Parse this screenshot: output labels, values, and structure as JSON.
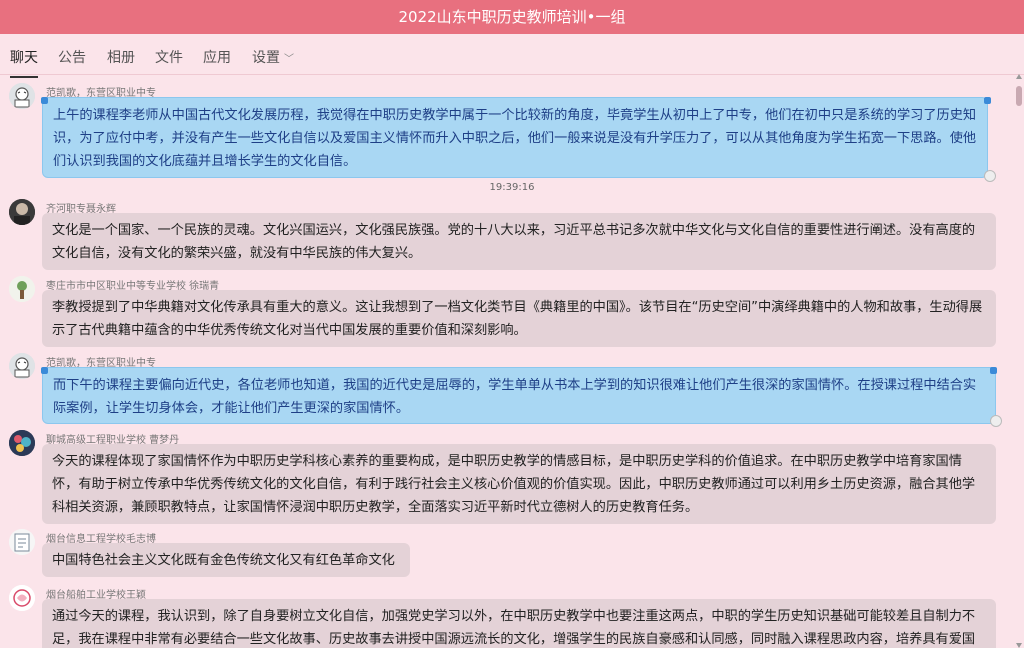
{
  "window": {
    "title": "2022山东中职历史教师培训•一组"
  },
  "tabs": [
    {
      "label": "聊天"
    },
    {
      "label": "公告"
    },
    {
      "label": "相册"
    },
    {
      "label": "文件"
    },
    {
      "label": "应用"
    },
    {
      "label": "设置"
    }
  ],
  "messages": [
    {
      "sender": "范凯歌，东营区职业中专",
      "text": "上午的课程李老师从中国古代文化发展历程，我觉得在中职历史教学中属于一个比较新的角度，毕竟学生从初中上了中专，他们在初中只是系统的学习了历史知识，为了应付中考，并没有产生一些文化自信以及爱国主义情怀而升入中职之后，他们一般来说是没有升学压力了，可以从其他角度为学生拓宽一下思路。使他们认识到我国的文化底蕴并且增长学生的文化自信。"
    },
    {
      "sender": "齐河职专聂永辉",
      "text": "文化是一个国家、一个民族的灵魂。文化兴国运兴，文化强民族强。党的十八大以来，习近平总书记多次就中华文化与文化自信的重要性进行阐述。没有高度的文化自信，没有文化的繁荣兴盛，就没有中华民族的伟大复兴。"
    },
    {
      "sender": "枣庄市市中区职业中等专业学校  徐瑞青",
      "text": "李教授提到了中华典籍对文化传承具有重大的意义。这让我想到了一档文化类节目《典籍里的中国》。该节目在“历史空间”中演绎典籍中的人物和故事，生动得展示了古代典籍中蕴含的中华优秀传统文化对当代中国发展的重要价值和深刻影响。"
    },
    {
      "sender": "范凯歌，东营区职业中专",
      "text": "而下午的课程主要偏向近代史，各位老师也知道，我国的近代史是屈辱的，学生单单从书本上学到的知识很难让他们产生很深的家国情怀。在授课过程中结合实际案例，让学生切身体会，才能让他们产生更深的家国情怀。"
    },
    {
      "sender": "聊城高级工程职业学校 曹梦丹",
      "text": "今天的课程体现了家国情怀作为中职历史学科核心素养的重要构成，是中职历史教学的情感目标，是中职历史学科的价值追求。在中职历史教学中培育家国情怀，有助于树立传承中华优秀传统文化的文化自信，有利于践行社会主义核心价值观的价值实现。因此，中职历史教师通过可以利用乡土历史资源，融合其他学科相关资源，兼顾职教特点，让家国情怀浸润中职历史教学，全面落实习近平新时代立德树人的历史教育任务。"
    },
    {
      "sender": "烟台信息工程学校毛志博",
      "text": "中国特色社会主义文化既有金色传统文化又有红色革命文化"
    },
    {
      "sender": "烟台船舶工业学校王颖",
      "text": "通过今天的课程，我认识到，除了自身要树立文化自信，加强党史学习以外，在中职历史教学中也要注重这两点，中职的学生历史知识基础可能较差且自制力不足，我在课程中非常有必要结合一些文化故事、历史故事去讲授中国源远流长的文化，增强学生的民族自豪感和认同感，同时融入课程思政内容，培养具有爱国"
    }
  ],
  "timestamp": "19:39:16",
  "colors": {
    "titlebar": "#e8707f",
    "background": "#fbe4ea",
    "bubble_gray": "#e4d2d7",
    "bubble_blue": "#a9d7f3"
  }
}
